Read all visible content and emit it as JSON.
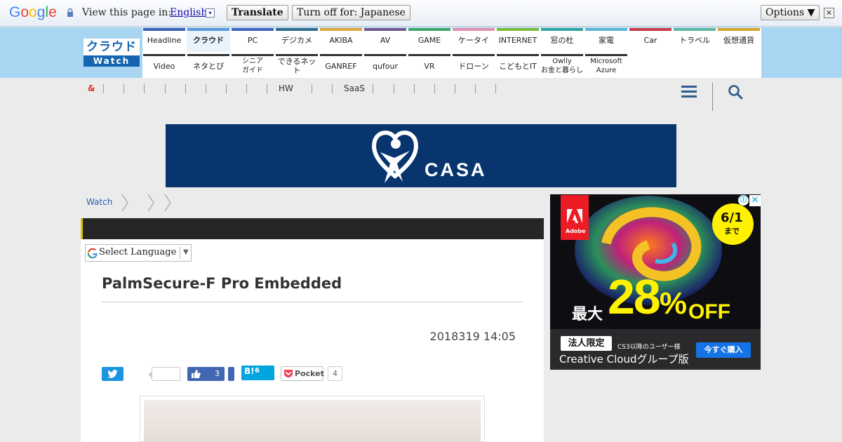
{
  "translate_bar": {
    "logo": "Google",
    "view_text": "View this page in:",
    "language": "English",
    "dropdown_glyph": "▾",
    "translate_label": "Translate",
    "turn_off_label": "Turn off for: Japanese",
    "options_label": "Options ▼",
    "close_glyph": "✕"
  },
  "site": {
    "logo_top": "クラウド",
    "logo_bottom": "Watch",
    "nav_row1": [
      {
        "label": "Headline",
        "color": "#3b64b5"
      },
      {
        "label": "クラウド",
        "color": "#5a9bd8",
        "selected": true
      },
      {
        "label": "PC",
        "color": "#3f67c6"
      },
      {
        "label": "デジカメ",
        "color": "#2d6b8d"
      },
      {
        "label": "AKIBA",
        "color": "#e3a638"
      },
      {
        "label": "AV",
        "color": "#6d5a8f"
      },
      {
        "label": "GAME",
        "color": "#3da66a"
      },
      {
        "label": "ケータイ",
        "color": "#e58fb0"
      },
      {
        "label": "INTERNET",
        "color": "#7cba3a"
      },
      {
        "label": "窓の杜",
        "color": "#2fa6a0"
      },
      {
        "label": "家電",
        "color": "#5ab5d8"
      },
      {
        "label": "Car",
        "color": "#c83b4a"
      },
      {
        "label": "トラベル",
        "color": "#5fb8a5"
      },
      {
        "label": "仮想通貨",
        "color": "#d4a72c"
      }
    ],
    "nav_row2": [
      {
        "label": "Video"
      },
      {
        "label": "ネタとぴ"
      },
      {
        "label": "シニア\nガイド"
      },
      {
        "label": "できるネット"
      },
      {
        "label": "GANREF"
      },
      {
        "label": "qufour"
      },
      {
        "label": "VR"
      },
      {
        "label": "ドローン"
      },
      {
        "label": "こどもとIT"
      },
      {
        "label": "Owlly\nお金と暮らし"
      },
      {
        "label": "Microsoft\nAzure"
      }
    ],
    "subnav": {
      "amp": "&",
      "hw": "HW",
      "saas": "SaaS"
    }
  },
  "banner": {
    "brand": "CASA",
    "icon": "heart-person-icon"
  },
  "breadcrumb": {
    "root": "Watch"
  },
  "article": {
    "select_language": "Select Language",
    "select_arrow": "▼",
    "title": "PalmSecure-F Pro Embedded",
    "date": "2018319 14:05",
    "share": {
      "like_count": "3",
      "hatena_count": "6",
      "hatena_label": "B!",
      "pocket_label": "Pocket",
      "pocket_count": "4"
    }
  },
  "side_ad": {
    "brand": "Adobe",
    "badge_top": "6/1",
    "badge_bottom": "まで",
    "max_label": "最大",
    "percent": "28",
    "percent_sign": "%",
    "off": "OFF",
    "tag": "法人限定",
    "subtitle": "CS3以降のユーザー様",
    "product": "Creative Cloudグループ版",
    "buy_label": "今すぐ購入",
    "info_glyph": "ⓘ",
    "close_glyph": "✕"
  },
  "colors": {
    "header_bg": "#a8d6f2",
    "banner_bg": "#09356f",
    "accent_yellow": "#fff200"
  }
}
